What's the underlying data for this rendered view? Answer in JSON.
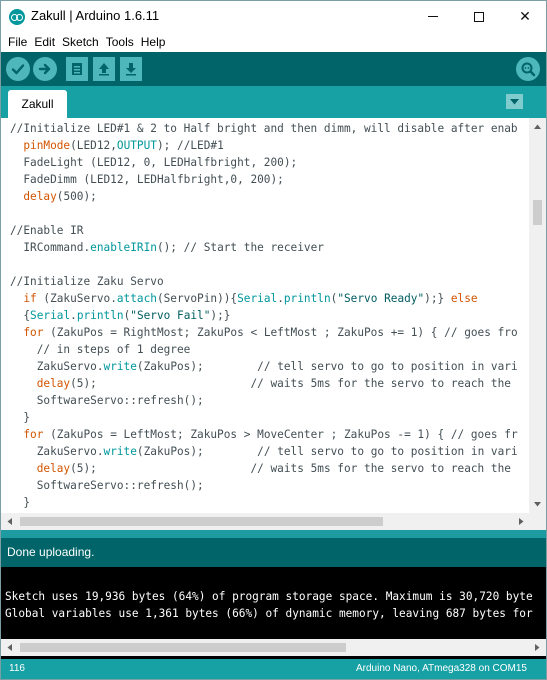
{
  "window": {
    "title": "Zakull | Arduino 1.6.11",
    "minimize_glyph": "",
    "maximize_glyph": "",
    "close_glyph": "✕"
  },
  "menu": {
    "items": [
      "File",
      "Edit",
      "Sketch",
      "Tools",
      "Help"
    ]
  },
  "toolbar": {
    "buttons": [
      "verify-icon",
      "upload-icon",
      "new-icon",
      "open-icon",
      "save-icon",
      "serial-monitor-icon"
    ]
  },
  "tabs": {
    "items": [
      {
        "label": "Zakull",
        "active": true
      }
    ]
  },
  "editor": {
    "lines": [
      "//Initialize LED#1 & 2 to Half bright and then dimm, will disable after enab",
      "  pinMode(LED12,OUTPUT); //LED#1",
      "  FadeLight (LED12, 0, LEDHalfbright, 200);",
      "  FadeDimm (LED12, LEDHalfbright,0, 200);",
      "  delay(500);",
      "",
      "//Enable IR",
      "  IRCommand.enableIRIn(); // Start the receiver",
      "",
      "//Initialize Zaku Servo",
      "  if (ZakuServo.attach(ServoPin)){Serial.println(\"Servo Ready\");} else",
      "  {Serial.println(\"Servo Fail\");}",
      "  for (ZakuPos = RightMost; ZakuPos < LeftMost ; ZakuPos += 1) { // goes fro",
      "    // in steps of 1 degree",
      "    ZakuServo.write(ZakuPos);        // tell servo to go to position in vari",
      "    delay(5);                       // waits 5ms for the servo to reach the",
      "    SoftwareServo::refresh();",
      "  }",
      "  for (ZakuPos = LeftMost; ZakuPos > MoveCenter ; ZakuPos -= 1) { // goes fr",
      "    ZakuServo.write(ZakuPos);        // tell servo to go to position in vari",
      "    delay(5);                       // waits 5ms for the servo to reach the",
      "    SoftwareServo::refresh();",
      "  }"
    ]
  },
  "status": {
    "message": "Done uploading."
  },
  "console": {
    "lines": [
      "Sketch uses 19,936 bytes (64%) of program storage space. Maximum is 30,720 byte",
      "Global variables use 1,361 bytes (66%) of dynamic memory, leaving 687 bytes for"
    ]
  },
  "footer": {
    "line_number": "116",
    "board": "Arduino Nano, ATmega328 on COM15"
  },
  "colors": {
    "toolbar": "#006468",
    "tabbar": "#17a1a5",
    "keyword_orange": "#d35400",
    "keyword_teal": "#00979c",
    "string": "#005c5f"
  }
}
